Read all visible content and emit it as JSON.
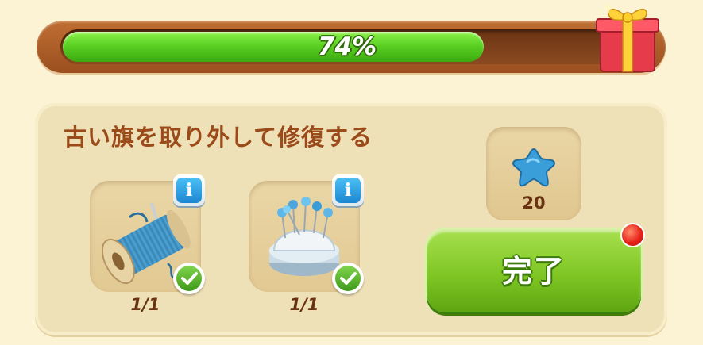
{
  "progress": {
    "value": 0.74,
    "label": "74%"
  },
  "quest": {
    "title": "古い旗を取り外して修復する",
    "items": [
      {
        "icon": "thread-spool-icon",
        "count": "1/1",
        "completed": true
      },
      {
        "icon": "pincushion-icon",
        "count": "1/1",
        "completed": true
      }
    ],
    "reward": {
      "icon": "blue-star-icon",
      "value": "20"
    },
    "complete_button": {
      "label": "完了",
      "has_notification": true
    }
  },
  "colors": {
    "progress_fill": "#5cd124",
    "title_text": "#9b4a1a",
    "button_green": "#7fc624",
    "info_blue": "#1b86d1",
    "notification_red": "#e8241a"
  },
  "info_glyph": "i"
}
